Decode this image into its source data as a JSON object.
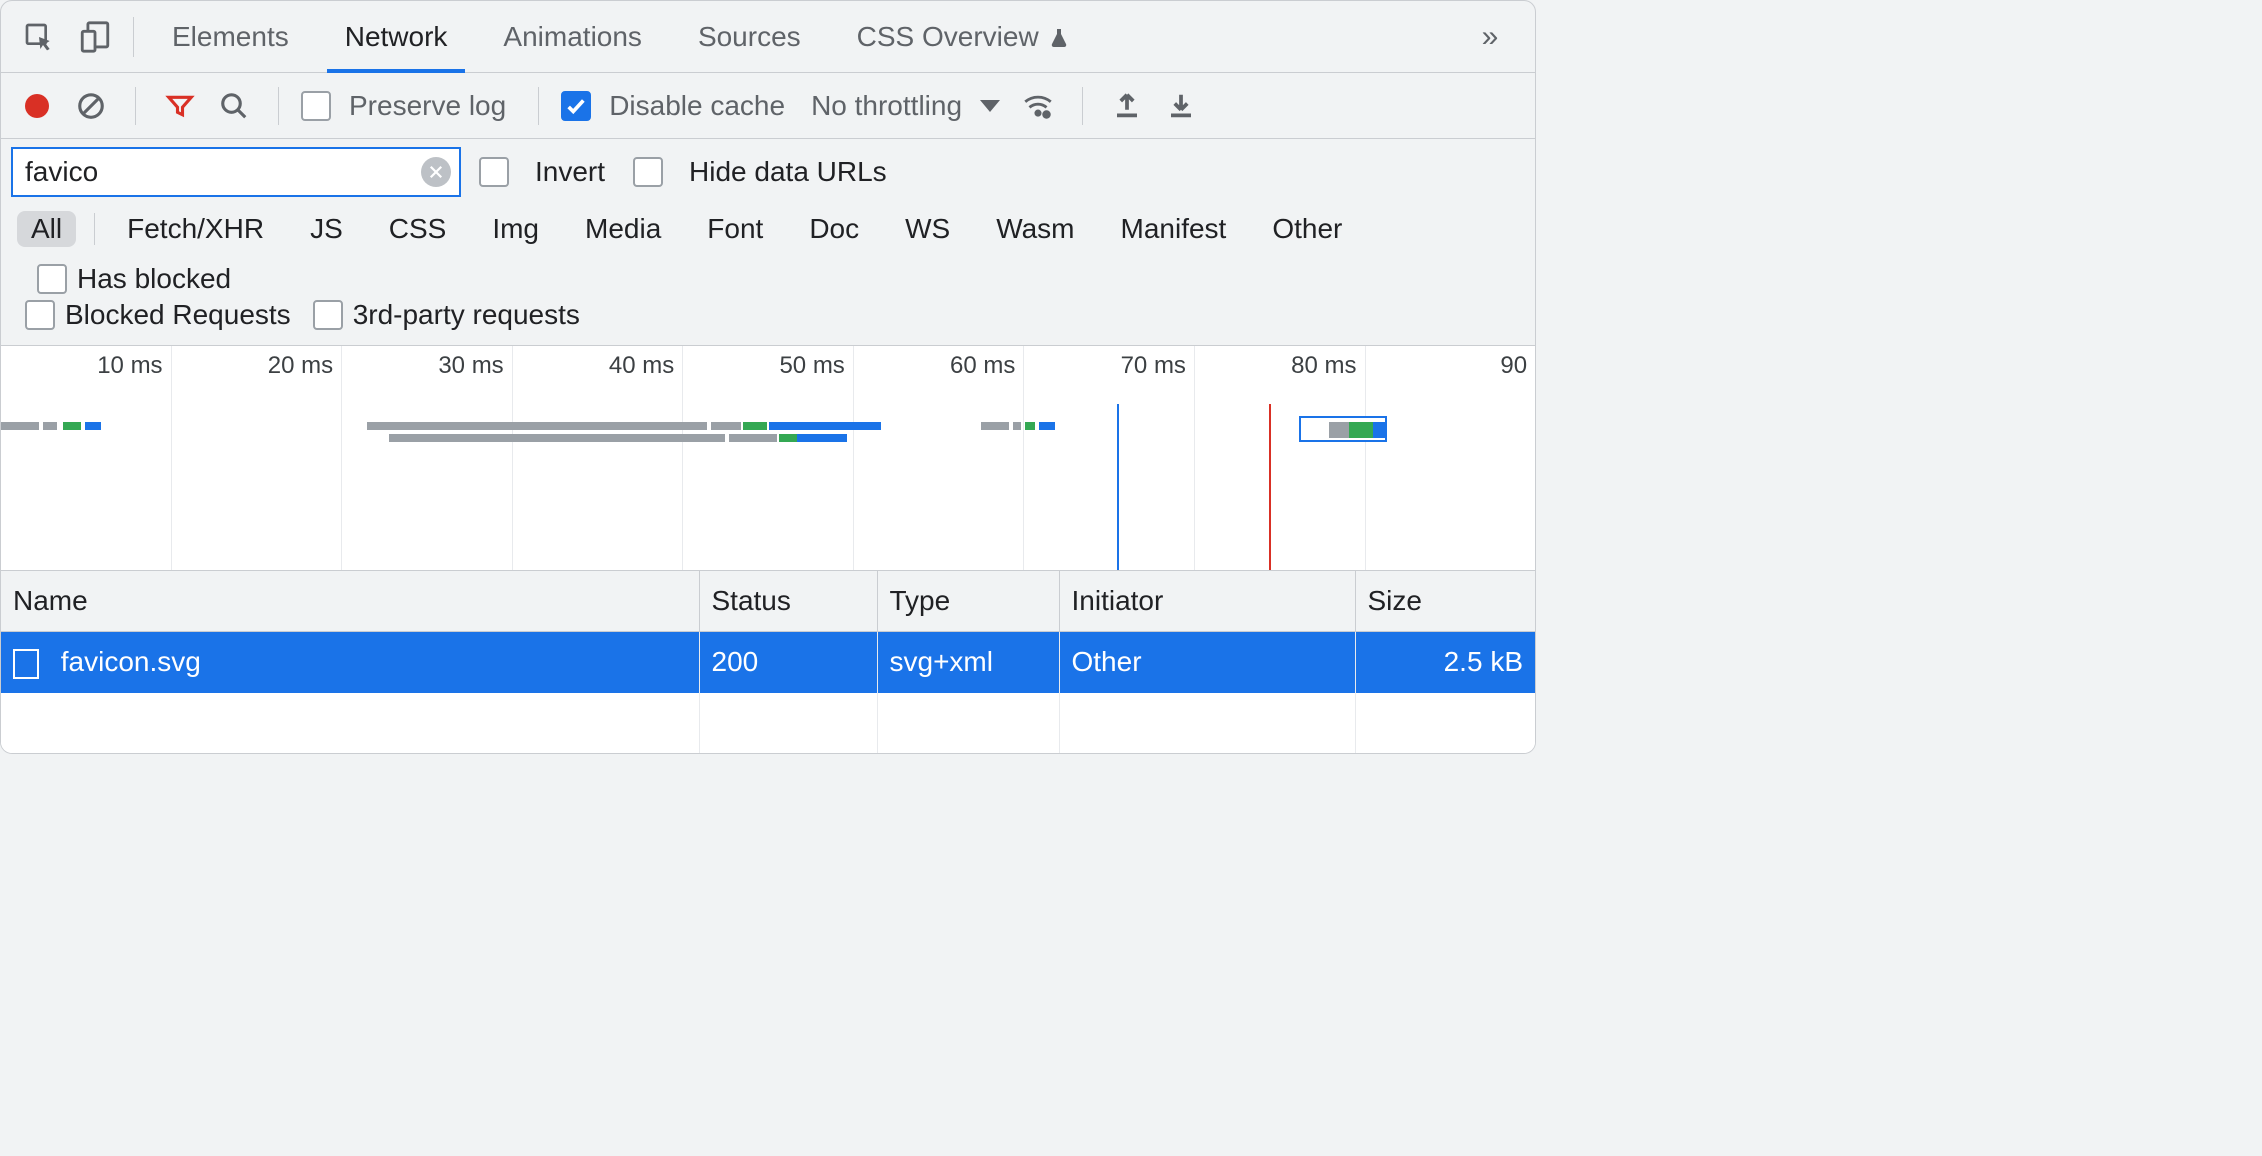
{
  "tabs": {
    "items": [
      "Elements",
      "Network",
      "Animations",
      "Sources",
      "CSS Overview"
    ],
    "active": "Network"
  },
  "toolbar": {
    "preserve_log_label": "Preserve log",
    "preserve_log_checked": false,
    "disable_cache_label": "Disable cache",
    "disable_cache_checked": true,
    "throttling_label": "No throttling"
  },
  "filter": {
    "value": "favico",
    "invert_label": "Invert",
    "invert_checked": false,
    "hide_data_urls_label": "Hide data URLs",
    "hide_data_urls_checked": false
  },
  "type_filters": {
    "items": [
      "All",
      "Fetch/XHR",
      "JS",
      "CSS",
      "Img",
      "Media",
      "Font",
      "Doc",
      "WS",
      "Wasm",
      "Manifest",
      "Other"
    ],
    "active": "All",
    "has_blocked_label": "Has blocked",
    "blocked_requests_label": "Blocked Requests",
    "third_party_label": "3rd-party requests"
  },
  "waterfall": {
    "ticks": [
      "10 ms",
      "20 ms",
      "30 ms",
      "40 ms",
      "50 ms",
      "60 ms",
      "70 ms",
      "80 ms",
      "90"
    ]
  },
  "table": {
    "columns": [
      "Name",
      "Status",
      "Type",
      "Initiator",
      "Size"
    ],
    "rows": [
      {
        "name": "favicon.svg",
        "status": "200",
        "type": "svg+xml",
        "initiator": "Other",
        "size": "2.5 kB"
      }
    ]
  }
}
